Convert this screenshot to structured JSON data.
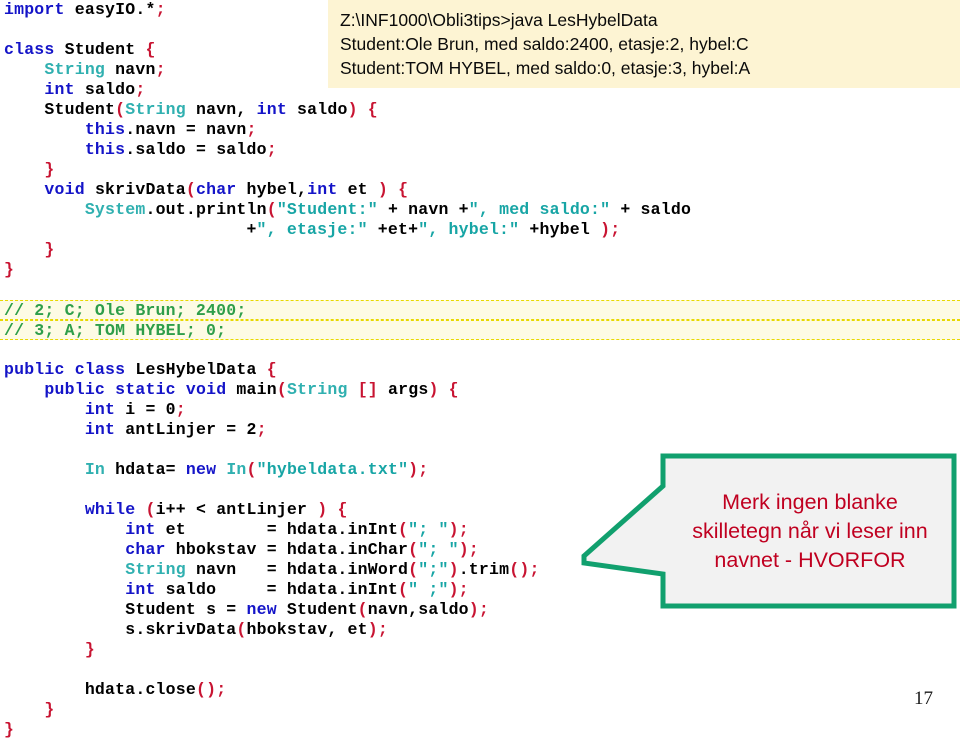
{
  "slide": {
    "page_number": "17"
  },
  "console": {
    "lines": [
      "Z:\\INF1000\\Obli3tips>java LesHybelData",
      "Student:Ole Brun, med saldo:2400, etasje:2, hybel:C",
      "Student:TOM HYBEL, med saldo:0, etasje:3, hybel:A"
    ],
    "background": "#fdf4d3"
  },
  "callout": {
    "text_lines": [
      "Merk ingen blanke",
      "skilletegn når vi leser inn",
      "navnet - HVORFOR"
    ],
    "border_color": "#11a06e",
    "fill_color": "#f2f2f2",
    "text_color": "#c00020"
  },
  "code": {
    "colors": {
      "keyword": "#1414c8",
      "type": "#30b0b0",
      "string": "#17a5a5",
      "punctuation": "#c81432",
      "comment": "#2e9e4a",
      "plain": "#000000",
      "highlight_background": "#fdfbe4",
      "highlight_border": "#e8d800"
    },
    "lines": [
      {
        "text": "import easyIO.*;"
      },
      {
        "text": ""
      },
      {
        "text": "class Student {"
      },
      {
        "text": "    String navn;"
      },
      {
        "text": "    int saldo;"
      },
      {
        "text": "    Student(String navn, int saldo) {"
      },
      {
        "text": "        this.navn = navn;"
      },
      {
        "text": "        this.saldo = saldo;"
      },
      {
        "text": "    }"
      },
      {
        "text": "    void skrivData(char hybel,int et ) {"
      },
      {
        "text": "        System.out.println(\"Student:\" + navn +\", med saldo:\" + saldo"
      },
      {
        "text": "                        +\", etasje:\" +et+\", hybel:\" +hybel );"
      },
      {
        "text": "    }"
      },
      {
        "text": "}"
      },
      {
        "text": ""
      },
      {
        "text": "// 2; C; Ole Brun; 2400;",
        "highlight": true
      },
      {
        "text": "// 3; A; TOM HYBEL; 0;",
        "highlight": true
      },
      {
        "text": ""
      },
      {
        "text": "public class LesHybelData {"
      },
      {
        "text": "    public static void main(String [] args) {"
      },
      {
        "text": "        int i = 0;"
      },
      {
        "text": "        int antLinjer = 2;"
      },
      {
        "text": ""
      },
      {
        "text": "        In hdata= new In(\"hybeldata.txt\");"
      },
      {
        "text": ""
      },
      {
        "text": "        while (i++ < antLinjer ) {"
      },
      {
        "text": "            int et        = hdata.inInt(\"; \");"
      },
      {
        "text": "            char hbokstav = hdata.inChar(\"; \");"
      },
      {
        "text": "            String navn   = hdata.inWord(\";\").trim();"
      },
      {
        "text": "            int saldo     = hdata.inInt(\" ;\");"
      },
      {
        "text": "            Student s = new Student(navn,saldo);"
      },
      {
        "text": "            s.skrivData(hbokstav, et);"
      },
      {
        "text": "        }"
      },
      {
        "text": ""
      },
      {
        "text": "        hdata.close();"
      },
      {
        "text": "    }"
      },
      {
        "text": "}"
      }
    ]
  }
}
